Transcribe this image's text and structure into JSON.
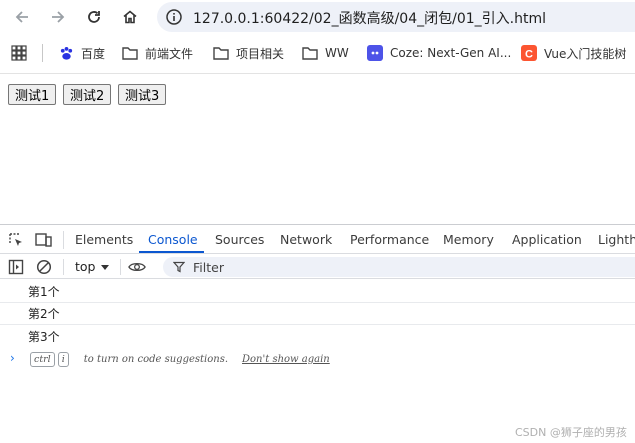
{
  "browser": {
    "url": "127.0.0.1:60422/02_函数高级/04_闭包/01_引入.html"
  },
  "bookmarks": [
    {
      "label": "百度",
      "icon": "baidu-paw-icon"
    },
    {
      "label": "前端文件",
      "icon": "folder-icon"
    },
    {
      "label": "项目相关",
      "icon": "folder-icon"
    },
    {
      "label": "WW",
      "icon": "folder-icon"
    },
    {
      "label": "Coze: Next-Gen AI...",
      "icon": "coze-icon"
    },
    {
      "label": "Vue入门技能树",
      "icon": "csdn-icon"
    }
  ],
  "page": {
    "buttons": [
      "测试1",
      "测试2",
      "测试3"
    ]
  },
  "devtools": {
    "tabs": [
      "Elements",
      "Console",
      "Sources",
      "Network",
      "Performance",
      "Memory",
      "Application",
      "Lighth"
    ],
    "active_tab": "Console",
    "context": "top",
    "filter_placeholder": "Filter",
    "logs": [
      "第1个",
      "第2个",
      "第3个"
    ],
    "hint": {
      "key1": "ctrl",
      "key2": "i",
      "text": "to turn on code suggestions.",
      "link": "Don't show again"
    }
  },
  "watermark": "CSDN @狮子座的男孩",
  "colors": {
    "accent": "#0b57d0",
    "omnibox_bg": "#eef1f8"
  }
}
